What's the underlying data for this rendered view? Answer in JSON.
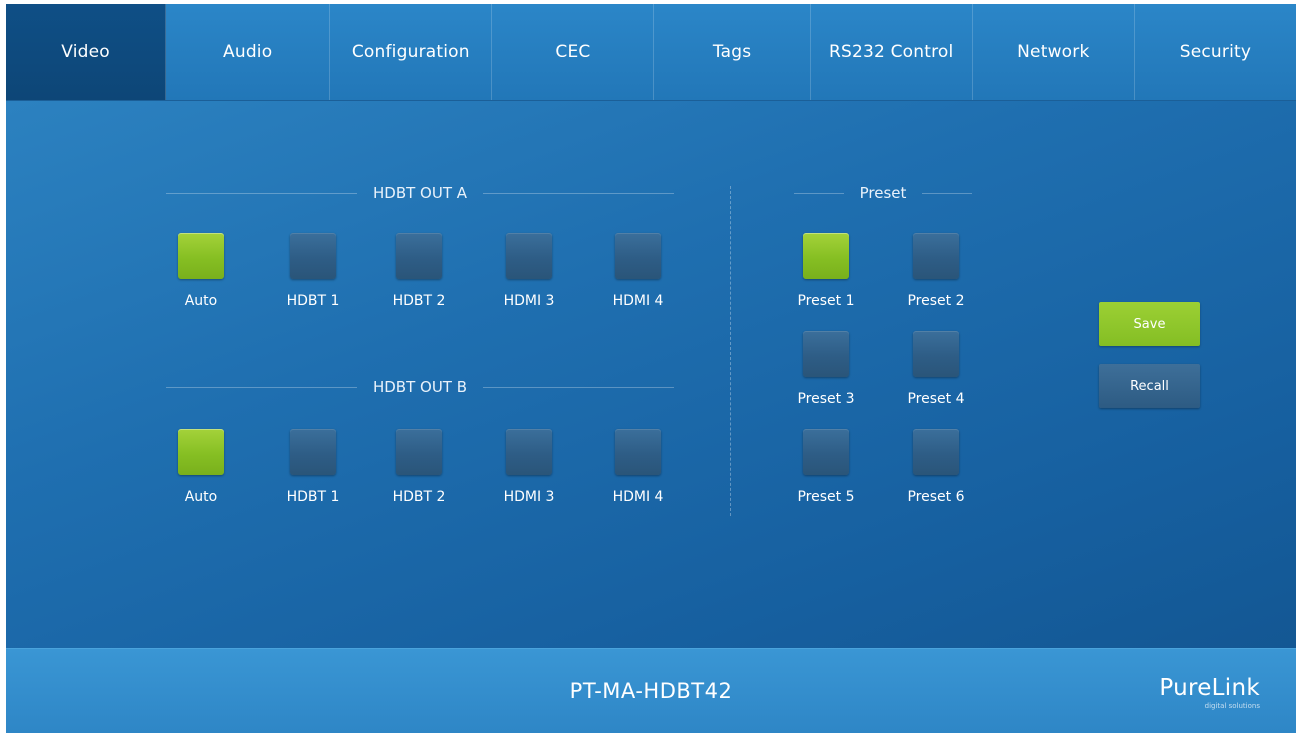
{
  "tabs": [
    {
      "label": "Video",
      "active": true
    },
    {
      "label": "Audio",
      "active": false
    },
    {
      "label": "Configuration",
      "active": false
    },
    {
      "label": "CEC",
      "active": false
    },
    {
      "label": "Tags",
      "active": false
    },
    {
      "label": "RS232 Control",
      "active": false
    },
    {
      "label": "Network",
      "active": false
    },
    {
      "label": "Security",
      "active": false
    }
  ],
  "hdbt_out_a": {
    "title": "HDBT OUT A",
    "sources": [
      {
        "label": "Auto",
        "selected": true
      },
      {
        "label": "HDBT 1",
        "selected": false
      },
      {
        "label": "HDBT 2",
        "selected": false
      },
      {
        "label": "HDMI 3",
        "selected": false
      },
      {
        "label": "HDMI 4",
        "selected": false
      }
    ]
  },
  "hdbt_out_b": {
    "title": "HDBT OUT B",
    "sources": [
      {
        "label": "Auto",
        "selected": true
      },
      {
        "label": "HDBT 1",
        "selected": false
      },
      {
        "label": "HDBT 2",
        "selected": false
      },
      {
        "label": "HDMI 3",
        "selected": false
      },
      {
        "label": "HDMI 4",
        "selected": false
      }
    ]
  },
  "preset": {
    "title": "Preset",
    "items": [
      {
        "label": "Preset 1",
        "selected": true
      },
      {
        "label": "Preset 2",
        "selected": false
      },
      {
        "label": "Preset 3",
        "selected": false
      },
      {
        "label": "Preset 4",
        "selected": false
      },
      {
        "label": "Preset 5",
        "selected": false
      },
      {
        "label": "Preset 6",
        "selected": false
      }
    ]
  },
  "actions": {
    "save_label": "Save",
    "recall_label": "Recall"
  },
  "footer": {
    "model": "PT-MA-HDBT42",
    "brand": "PureLink",
    "tagline": "digital solutions"
  },
  "colors": {
    "accent_green": "#86bf23",
    "tab_active": "#0f4f86",
    "panel_blue": "#1f6fb0"
  }
}
